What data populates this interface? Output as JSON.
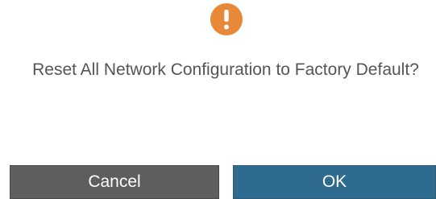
{
  "dialog": {
    "icon": "warning-icon",
    "icon_color": "#e8893a",
    "message": "Reset All Network Configuration to Factory Default?",
    "cancel_label": "Cancel",
    "ok_label": "OK",
    "cancel_color": "#5e5e61",
    "ok_color": "#2f6b8f"
  }
}
